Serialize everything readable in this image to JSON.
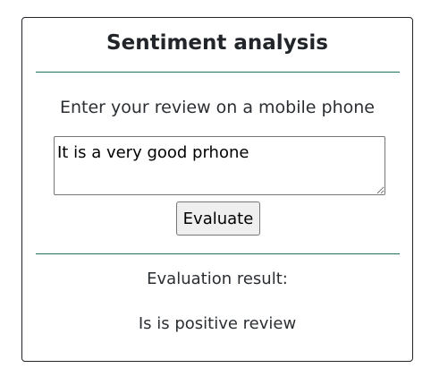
{
  "card": {
    "title": "Sentiment analysis",
    "prompt": "Enter your review on a mobile phone",
    "review_value": "It is a very good prhone",
    "evaluate_label": "Evaluate",
    "result_label": "Evaluation result:",
    "result_value": "Is is positive review"
  },
  "colors": {
    "divider": "#1f6f5c",
    "text": "#212529",
    "button_bg": "#efefef",
    "border": "#212529"
  }
}
